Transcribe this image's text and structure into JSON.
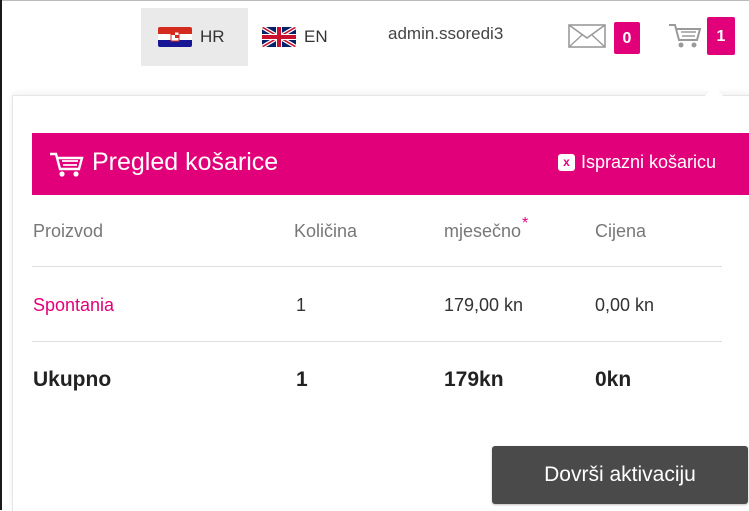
{
  "topbar": {
    "lang_hr": "HR",
    "lang_en": "EN",
    "username": "admin.ssoredi3",
    "mail_count": "0",
    "cart_count": "1"
  },
  "cart": {
    "title": "Pregled košarice",
    "empty_label": "Isprazni košaricu",
    "columns": [
      "Proizvod",
      "Količina",
      "mjesečno",
      "Cijena"
    ],
    "monthly_marker": "*",
    "rows": [
      {
        "product": "Spontania",
        "quantity": "1",
        "monthly": "179,00 kn",
        "price": "0,00 kn"
      }
    ],
    "total": {
      "label": "Ukupno",
      "quantity": "1",
      "monthly": "179kn",
      "price": "0kn"
    },
    "activate_label": "Dovrši aktivaciju"
  },
  "colors": {
    "accent": "#e2007a",
    "button": "#4a4a4a"
  },
  "icons": {
    "mail": "mail-icon",
    "cart": "cart-icon",
    "close": "close-icon"
  }
}
